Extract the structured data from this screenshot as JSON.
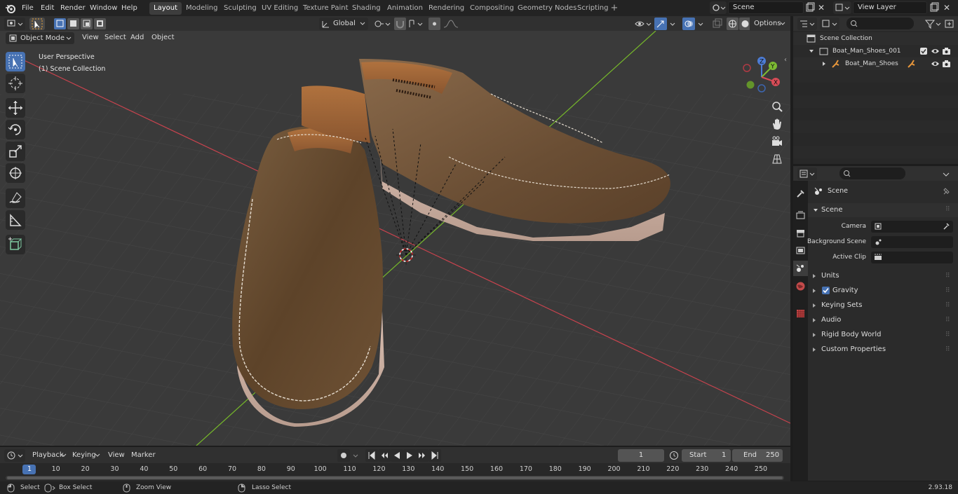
{
  "topbar": {
    "menus": [
      "File",
      "Edit",
      "Render",
      "Window",
      "Help"
    ],
    "workspaces": [
      "Layout",
      "Modeling",
      "Sculpting",
      "UV Editing",
      "Texture Paint",
      "Shading",
      "Animation",
      "Rendering",
      "Compositing",
      "Geometry Nodes",
      "Scripting"
    ],
    "active_workspace": "Layout",
    "scene_name": "Scene",
    "view_layer": "View Layer",
    "add_symbol": "+"
  },
  "viewport_header": {
    "mode": "Object Mode",
    "menus": [
      "View",
      "Select",
      "Add",
      "Object"
    ],
    "transform_orientation": "Global",
    "options_label": "Options"
  },
  "viewport": {
    "perspective_label": "User Perspective",
    "collection_label": "(1) Scene Collection",
    "gizmo_axes": {
      "x": "X",
      "y": "Y",
      "z": "Z"
    },
    "colors": {
      "x_axis": "#c9434e",
      "y_axis": "#76b82a",
      "background": "#3a3a3a",
      "grid": "#474747"
    }
  },
  "outliner": {
    "root": "Scene Collection",
    "items": [
      {
        "label": "Boat_Man_Shoes_001",
        "level": 1
      },
      {
        "label": "Boat_Man_Shoes",
        "level": 2
      }
    ]
  },
  "properties": {
    "context": "Scene",
    "section": "Scene",
    "fields": [
      {
        "label": "Camera"
      },
      {
        "label": "Background Scene"
      },
      {
        "label": "Active Clip"
      }
    ],
    "panels": [
      "Units",
      "Gravity",
      "Keying Sets",
      "Audio",
      "Rigid Body World",
      "Custom Properties"
    ],
    "gravity_checked": true
  },
  "timeline": {
    "menus": [
      "Playback",
      "Keying",
      "View",
      "Marker"
    ],
    "current_frame": "1",
    "start_label": "Start",
    "start_value": "1",
    "end_label": "End",
    "end_value": "250",
    "ticks": [
      "1",
      "10",
      "20",
      "30",
      "40",
      "50",
      "60",
      "70",
      "80",
      "90",
      "100",
      "110",
      "120",
      "130",
      "140",
      "150",
      "160",
      "170",
      "180",
      "190",
      "200",
      "210",
      "220",
      "230",
      "240",
      "250"
    ]
  },
  "statusbar": {
    "select": "Select",
    "box_select": "Box Select",
    "zoom_view": "Zoom View",
    "lasso_select": "Lasso Select",
    "version": "2.93.18"
  }
}
